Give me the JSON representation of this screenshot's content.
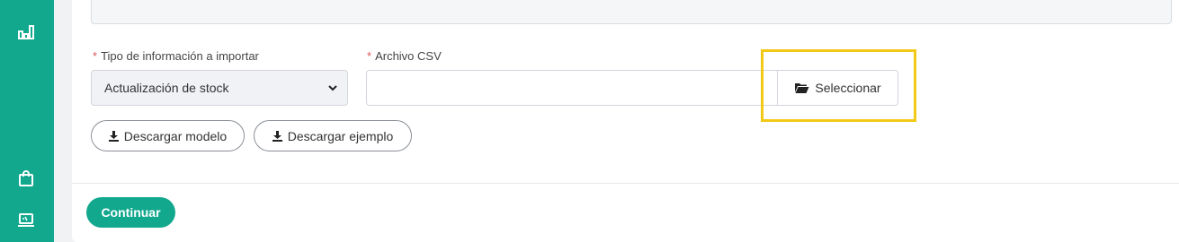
{
  "sidebar": {
    "background": "#11a88e",
    "icons": [
      "chart-icon",
      "shopping-bag-icon",
      "laptop-icon"
    ]
  },
  "form": {
    "tipo": {
      "required_mark": "*",
      "label": "Tipo de información a importar",
      "selected": "Actualización de stock"
    },
    "csv": {
      "required_mark": "*",
      "label": "Archivo CSV",
      "value": "",
      "select_button": "Seleccionar"
    },
    "download_model": "Descargar modelo",
    "download_example": "Descargar ejemplo"
  },
  "footer": {
    "continue": "Continuar"
  },
  "colors": {
    "accent": "#11a88e",
    "highlight": "#f2c916",
    "required": "#e05555"
  }
}
